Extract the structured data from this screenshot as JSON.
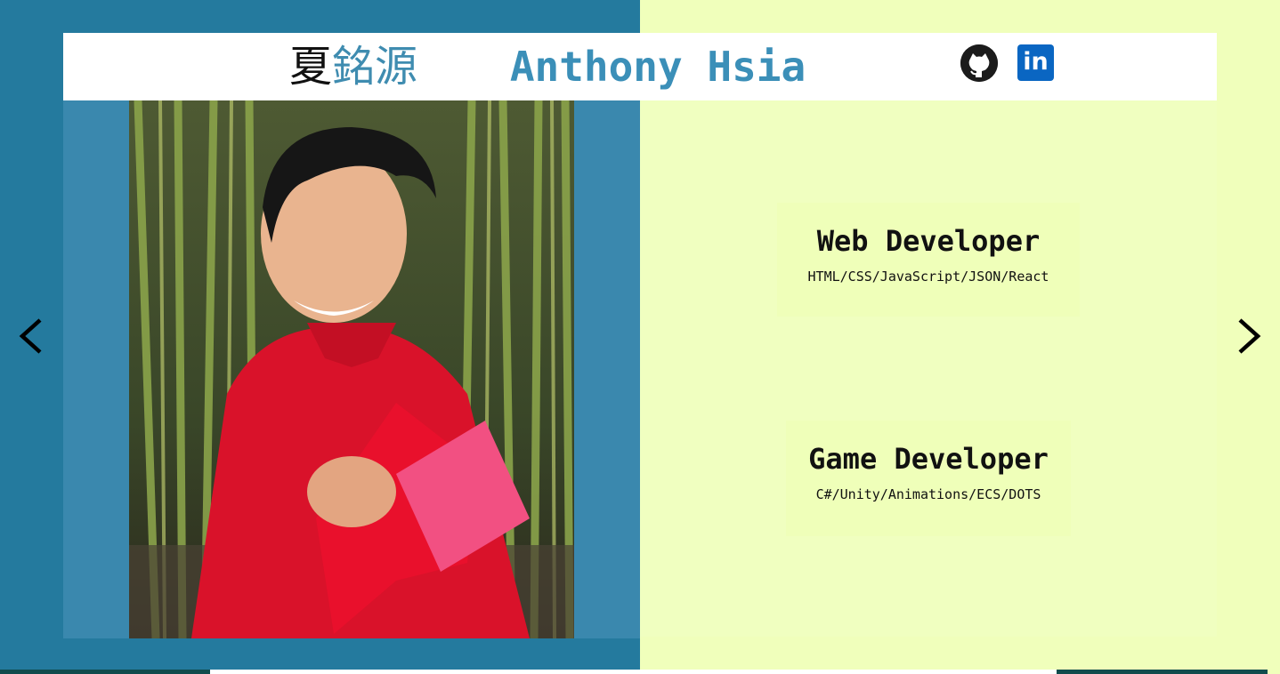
{
  "header": {
    "chinese_first": "夏",
    "chinese_rest": "銘源",
    "english_name": "Anthony Hsia",
    "github_icon": "github-icon",
    "linkedin_label": "in"
  },
  "photo": {
    "description_icon": "portrait-photo"
  },
  "roles": [
    {
      "title": "Web Developer",
      "skills": "HTML/CSS/JavaScript/JSON/React"
    },
    {
      "title": "Game Developer",
      "skills": "C#/Unity/Animations/ECS/DOTS"
    }
  ],
  "nav": {
    "prev_icon": "chevron-left-icon",
    "next_icon": "chevron-right-icon"
  },
  "colors": {
    "left_bg": "#247a9e",
    "right_bg": "#f0ffbb",
    "name_blue": "#3b8fb8",
    "linkedin": "#0a66c2"
  }
}
